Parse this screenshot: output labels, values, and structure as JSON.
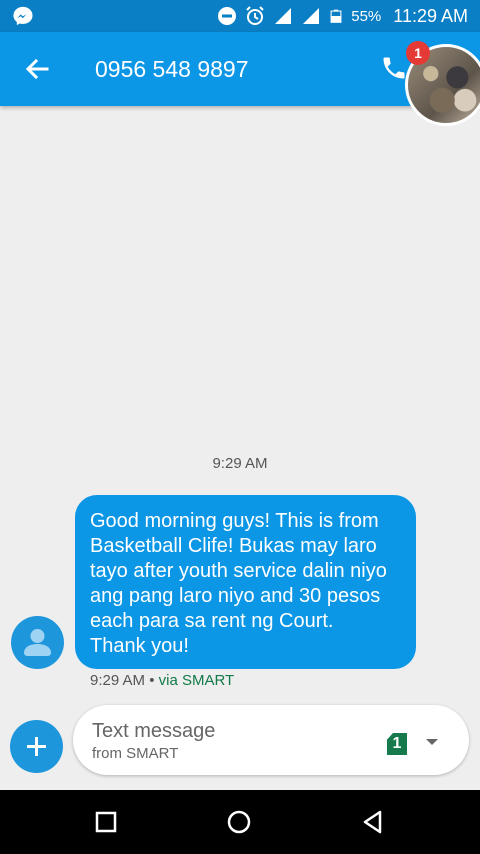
{
  "status_bar": {
    "battery": "55%",
    "time": "11:29 AM"
  },
  "app_bar": {
    "title": "0956 548 9897",
    "chat_head_badge": "1"
  },
  "conversation": {
    "timestamp": "9:29 AM",
    "message": {
      "text": "Good morning guys! This is from\nBasketball Clife! Bukas may laro\ntayo after youth service dalin niyo\nang pang laro niyo and 30 pesos\neach para sa rent ng Court.\nThank you!",
      "time": "9:29 AM",
      "separator": " • ",
      "via": "via SMART"
    }
  },
  "composer": {
    "placeholder": "Text message",
    "sub": "from SMART",
    "sim_label": "1"
  },
  "colors": {
    "status_bar": "#0b7fc5",
    "app_bar": "#0b96e6",
    "bubble": "#0b96e6",
    "background": "#eeeeee",
    "sim": "#177a4c",
    "badge": "#e53935"
  },
  "icons": [
    "messenger-icon",
    "dnd-icon",
    "alarm-icon",
    "signal-icon",
    "battery-icon",
    "back-arrow-icon",
    "phone-icon",
    "person-icon",
    "plus-icon",
    "sim-icon",
    "dropdown-icon",
    "recents-icon",
    "home-icon",
    "back-icon"
  ]
}
